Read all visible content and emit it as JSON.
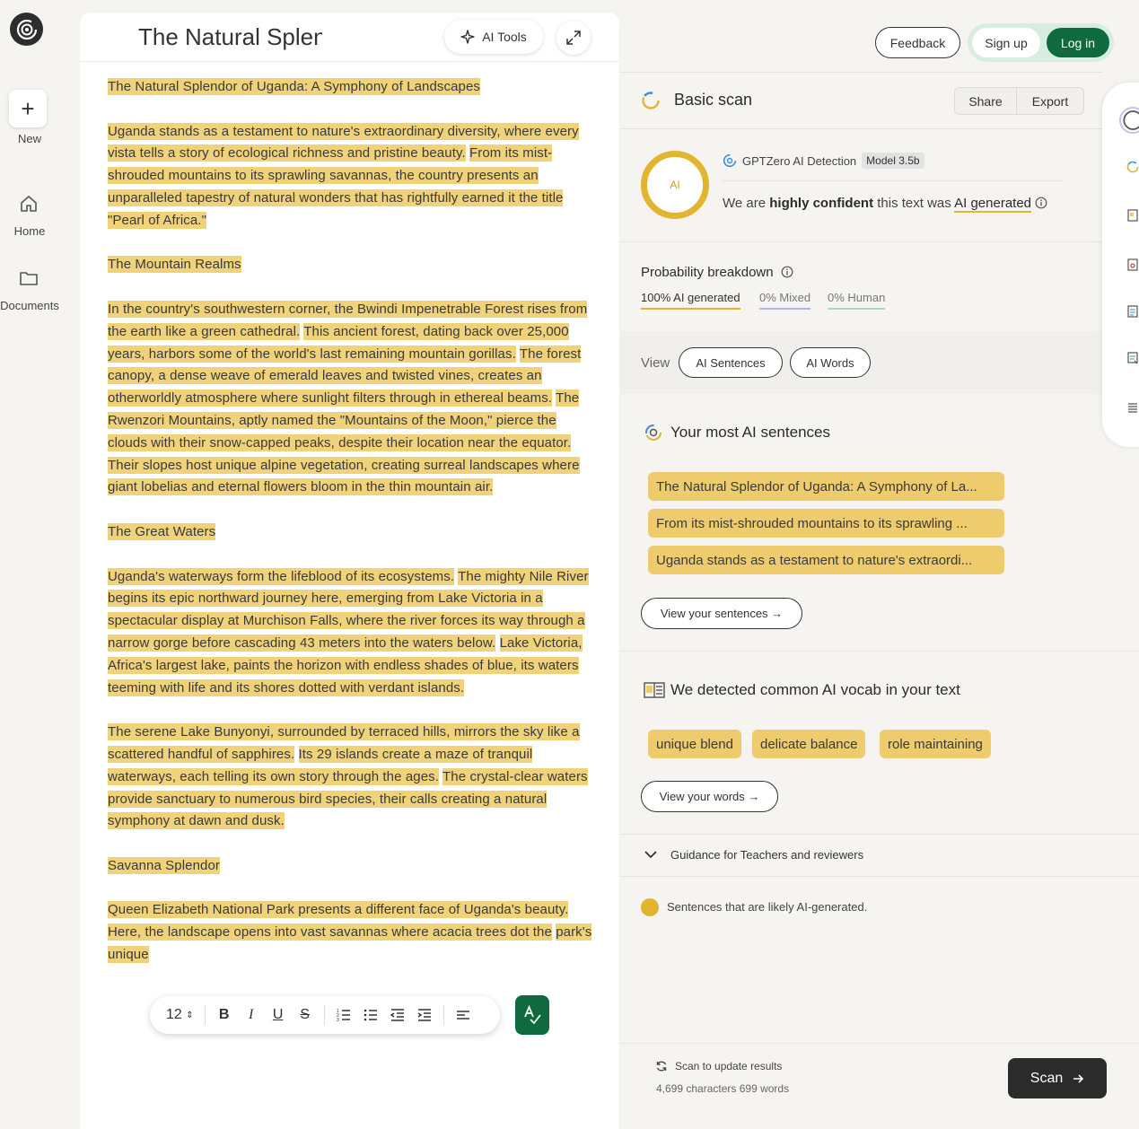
{
  "rail": {
    "new_label": "New",
    "home_label": "Home",
    "documents_label": "Documents"
  },
  "editor": {
    "title": "The Natural Splendor",
    "ai_tools_label": "AI Tools",
    "paragraphs": [
      [
        "The Natural Splendor of Uganda: A Symphony of Landscapes"
      ],
      [
        "Uganda stands as a testament to nature's extraordinary diversity, where every vista tells a story of ecological richness and pristine beauty.",
        "From its mist-shrouded mountains to its sprawling savannas, the country presents an unparalleled tapestry of natural wonders that has rightfully earned it the title \"Pearl of Africa.\""
      ],
      [
        "The Mountain Realms"
      ],
      [
        "In the country's southwestern corner, the Bwindi Impenetrable Forest rises from the earth like a green cathedral.",
        "This ancient forest, dating back over 25,000 years, harbors some of the world's last remaining mountain gorillas.",
        "The forest canopy, a dense weave of emerald leaves and twisted vines, creates an otherworldly atmosphere where sunlight filters through in ethereal beams.",
        "The Rwenzori Mountains, aptly named the \"Mountains of the Moon,\" pierce the clouds with their snow-capped peaks, despite their location near the equator.",
        "Their slopes host unique alpine vegetation, creating surreal landscapes where giant lobelias and eternal flowers bloom in the thin mountain air."
      ],
      [
        "The Great Waters"
      ],
      [
        "Uganda's waterways form the lifeblood of its ecosystems.",
        "The mighty Nile River begins its epic northward journey here, emerging from Lake Victoria in a spectacular display at Murchison Falls, where the river forces its way through a narrow gorge before cascading 43 meters into the waters below.",
        "Lake Victoria, Africa's largest lake, paints the horizon with endless shades of blue, its waters teeming with life and its shores dotted with verdant islands."
      ],
      [
        "The serene Lake Bunyonyi, surrounded by terraced hills, mirrors the sky like a scattered handful of sapphires.",
        "Its 29 islands create a maze of tranquil waterways, each telling its own story through the ages.",
        "The crystal-clear waters provide sanctuary to numerous bird species, their calls creating a natural symphony at dawn and dusk."
      ],
      [
        "Savanna Splendor"
      ],
      [
        "Queen Elizabeth National Park presents a different face of Uganda's beauty.",
        "Here, the landscape opens into vast savannas where acacia trees dot the",
        "park's unique"
      ]
    ],
    "toolbar": {
      "font_size": "12",
      "bold": "B",
      "italic": "I",
      "underline": "U",
      "strike": "S"
    }
  },
  "header": {
    "feedback": "Feedback",
    "signup": "Sign up",
    "login": "Log in"
  },
  "scan": {
    "title": "Basic scan",
    "share": "Share",
    "export": "Export",
    "ring_label": "AI",
    "detector": "GPTZero AI Detection",
    "model": "Model 3.5b",
    "conf_prefix": "We are",
    "conf_bold": "highly confident",
    "conf_mid": "this text was",
    "conf_result": "AI generated",
    "prob_title": "Probability breakdown",
    "prob_ai": "100% AI generated",
    "prob_mixed": "0% Mixed",
    "prob_human": "0% Human",
    "view_label": "View",
    "view_sentences": "AI Sentences",
    "view_words": "AI Words",
    "sentences_title": "Your most AI sentences",
    "sentences": [
      "The Natural Splendor of Uganda: A Symphony of La...",
      "From its mist-shrouded mountains to its sprawling ...",
      "Uganda stands as a testament to nature's extraordi..."
    ],
    "view_sentences_btn": "View your sentences →",
    "vocab_title": "We detected common AI vocab in your text",
    "vocab": [
      "unique blend",
      "delicate balance",
      "role maintaining"
    ],
    "view_words_btn": "View your words →",
    "guidance": "Guidance for Teachers and reviewers",
    "legend": "Sentences that are likely AI-generated.",
    "update": "Scan to update results",
    "counts": "4,699 characters 699 words",
    "scan_btn": "Scan"
  },
  "colors": {
    "highlight": "#f0d27a",
    "accent_green": "#0f6b3f",
    "ai_yellow": "#e2b52e",
    "mixed": "#b7b3e0",
    "human": "#a9d8c5"
  }
}
